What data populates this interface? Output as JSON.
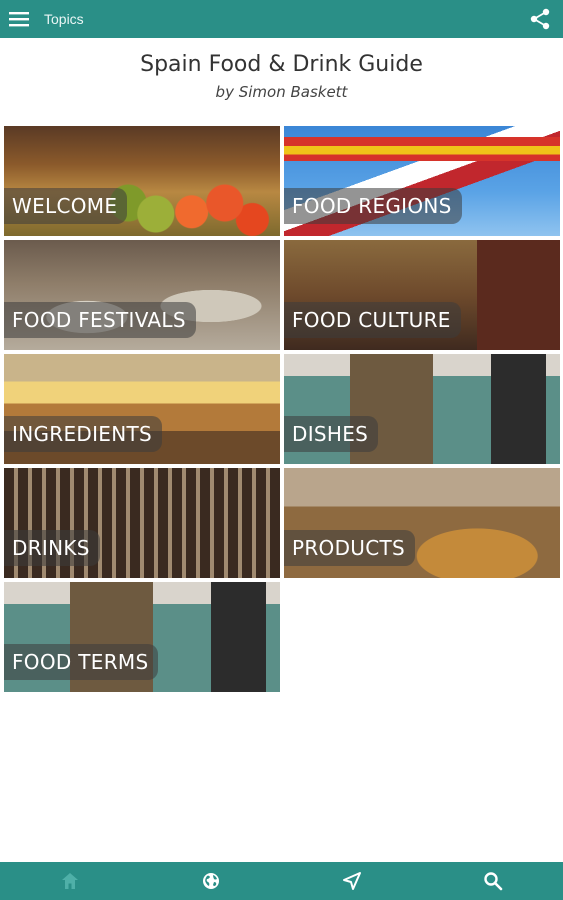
{
  "topbar": {
    "title": "Topics",
    "menu_icon": "hamburger-menu-icon",
    "share_icon": "share-icon"
  },
  "header": {
    "title": "Spain Food & Drink Guide",
    "author": "by Simon Baskett"
  },
  "topics": [
    {
      "label": "WELCOME"
    },
    {
      "label": "FOOD REGIONS"
    },
    {
      "label": "FOOD FESTIVALS"
    },
    {
      "label": "FOOD CULTURE"
    },
    {
      "label": "INGREDIENTS"
    },
    {
      "label": "DISHES"
    },
    {
      "label": "DRINKS"
    },
    {
      "label": "PRODUCTS"
    },
    {
      "label": "FOOD TERMS"
    }
  ],
  "bottom_nav": [
    {
      "icon": "home-icon",
      "state": "disabled"
    },
    {
      "icon": "globe-icon",
      "state": "active"
    },
    {
      "icon": "navigation-arrow-icon",
      "state": "active"
    },
    {
      "icon": "search-icon",
      "state": "active"
    }
  ],
  "colors": {
    "bar": "#2a8f87",
    "label_overlay": "rgba(60,60,60,0.55)"
  }
}
